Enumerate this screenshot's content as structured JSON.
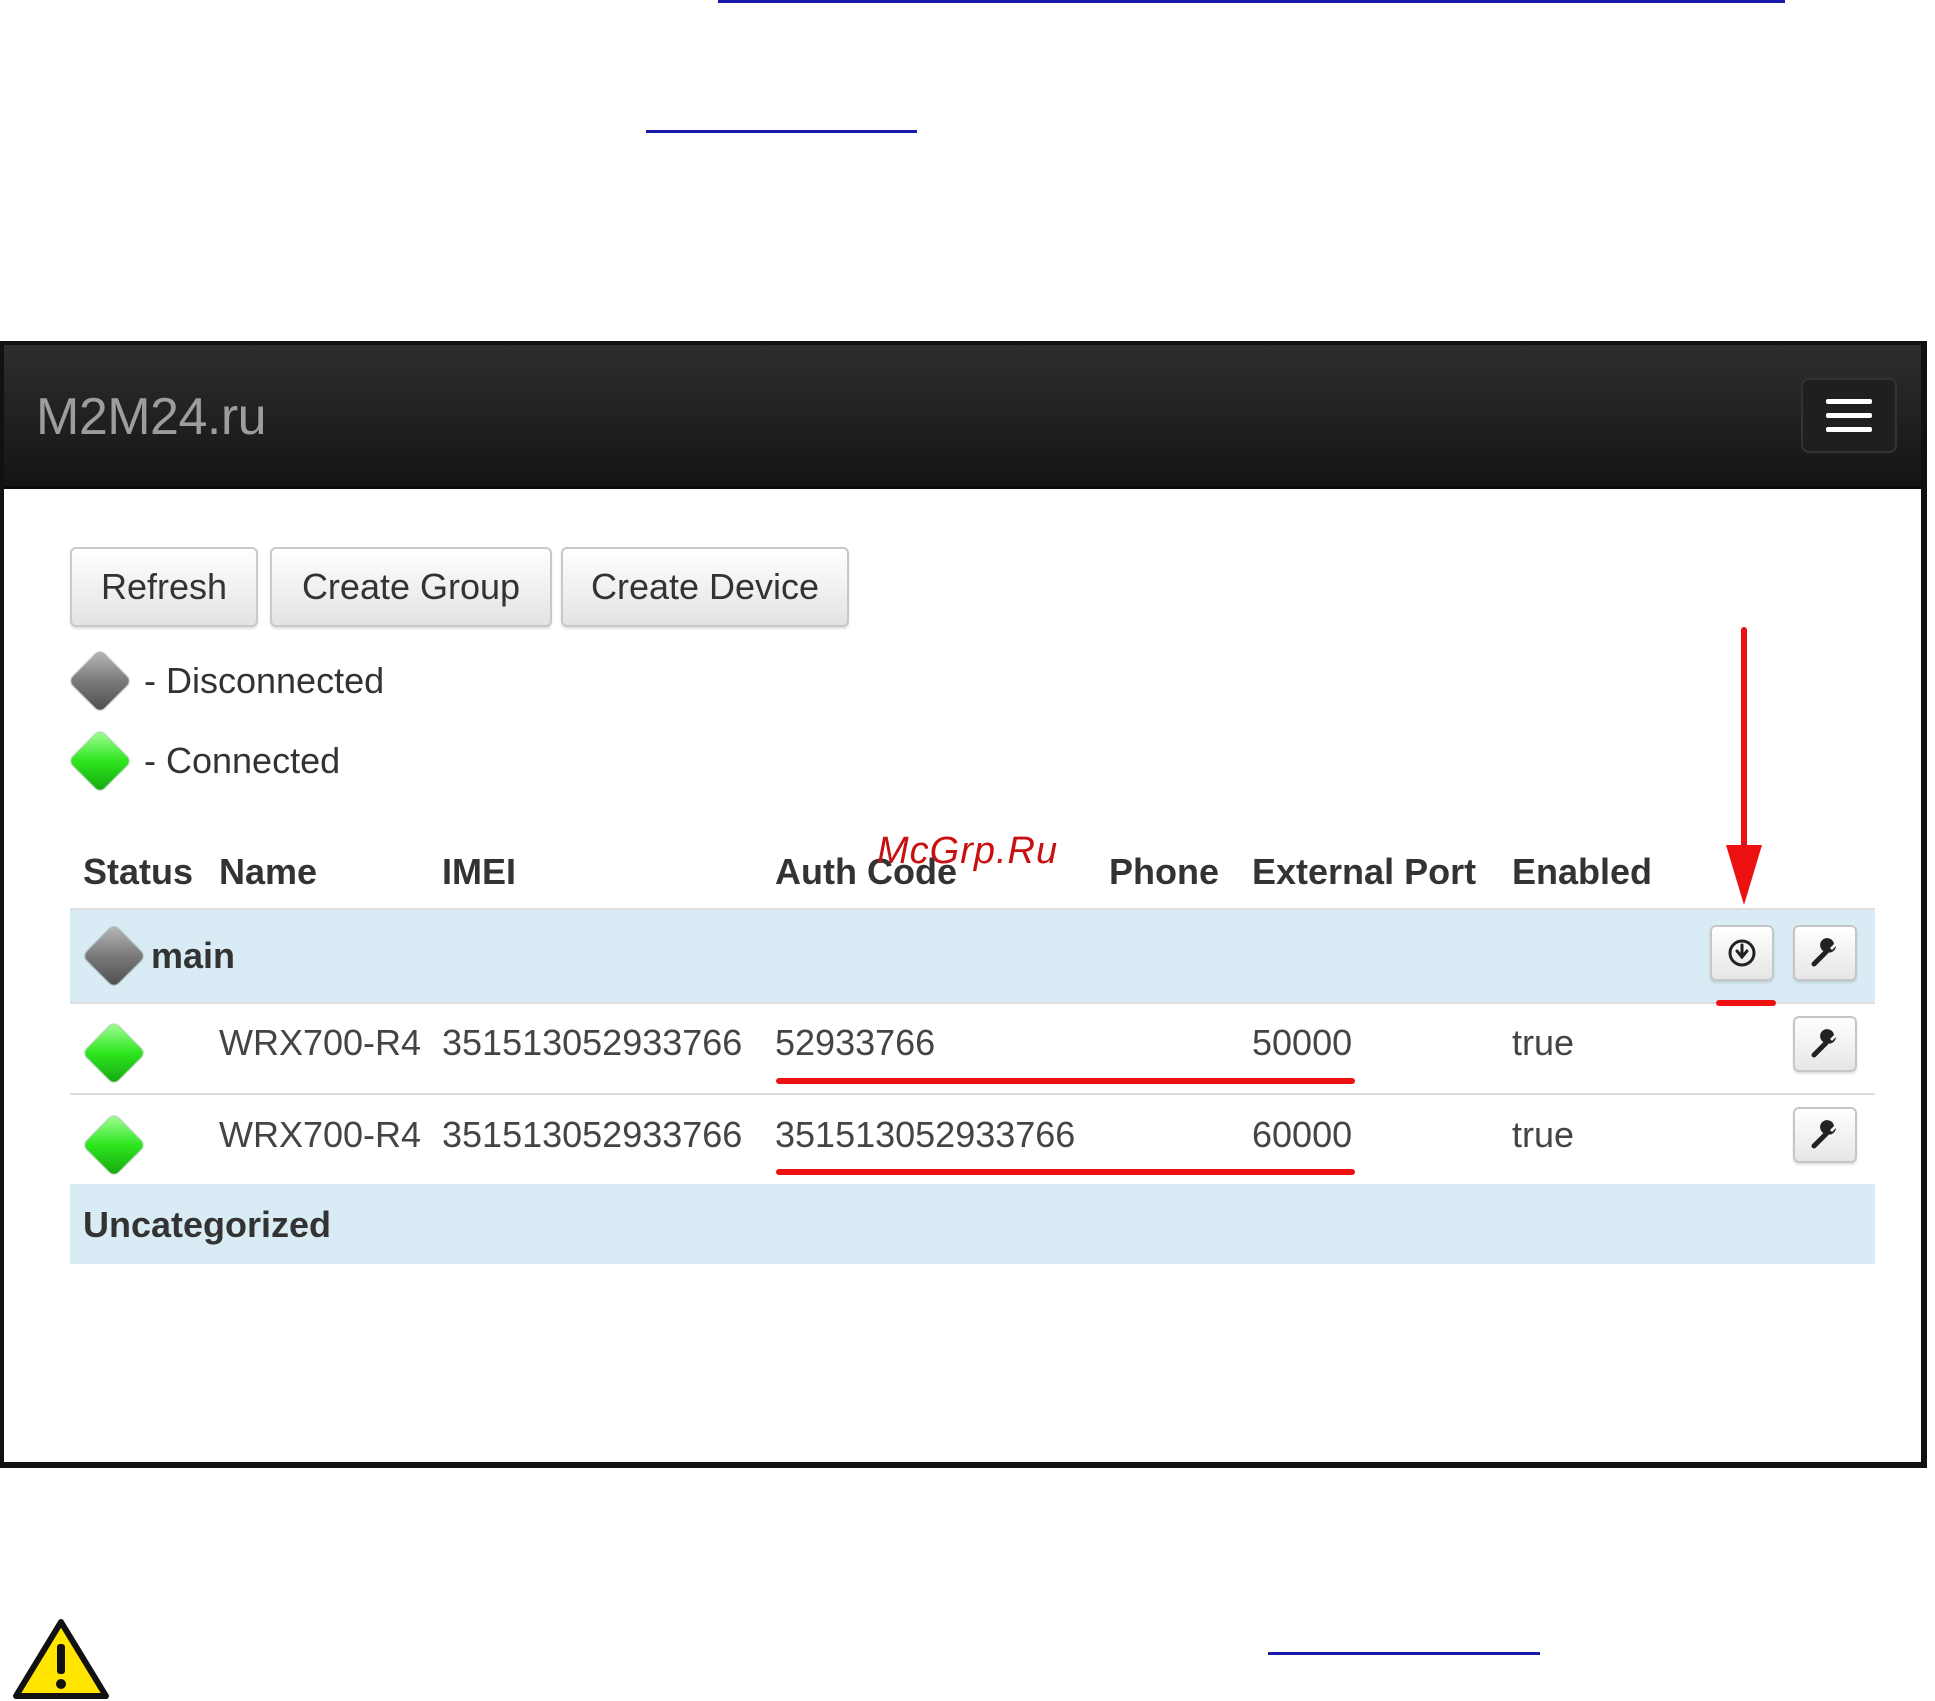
{
  "app": {
    "brand": "M2M24.ru",
    "toolbar": {
      "refresh": "Refresh",
      "create_group": "Create Group",
      "create_device": "Create Device"
    },
    "legend": {
      "disconnected": "- Disconnected",
      "connected": "- Connected"
    },
    "table": {
      "headers": [
        "Status",
        "Name",
        "IMEI",
        "Auth Code",
        "Phone",
        "External Port",
        "Enabled"
      ],
      "groups": [
        {
          "name": "main",
          "status": "disconnected",
          "devices": [
            {
              "status": "connected",
              "name": "WRX700-R4",
              "imei": "351513052933766",
              "auth_code": "52933766",
              "phone": "",
              "external_port": "50000",
              "enabled": "true"
            },
            {
              "status": "connected",
              "name": "WRX700-R4",
              "imei": "351513052933766",
              "auth_code": "351513052933766",
              "phone": "",
              "external_port": "60000",
              "enabled": "true"
            }
          ]
        },
        {
          "name": "Uncategorized",
          "devices": []
        }
      ]
    }
  },
  "watermark": "McGrp.Ru",
  "colors": {
    "navbar": "#1b1b1b",
    "group_row": "#d9ecf5",
    "connected": "#2ee61f",
    "disconnected": "#7a7a7a",
    "annotation": "#ee1111"
  },
  "icons": {
    "menu": "hamburger-icon",
    "download": "download-circle-icon",
    "settings": "wrench-icon",
    "warning": "warning-triangle-icon"
  }
}
